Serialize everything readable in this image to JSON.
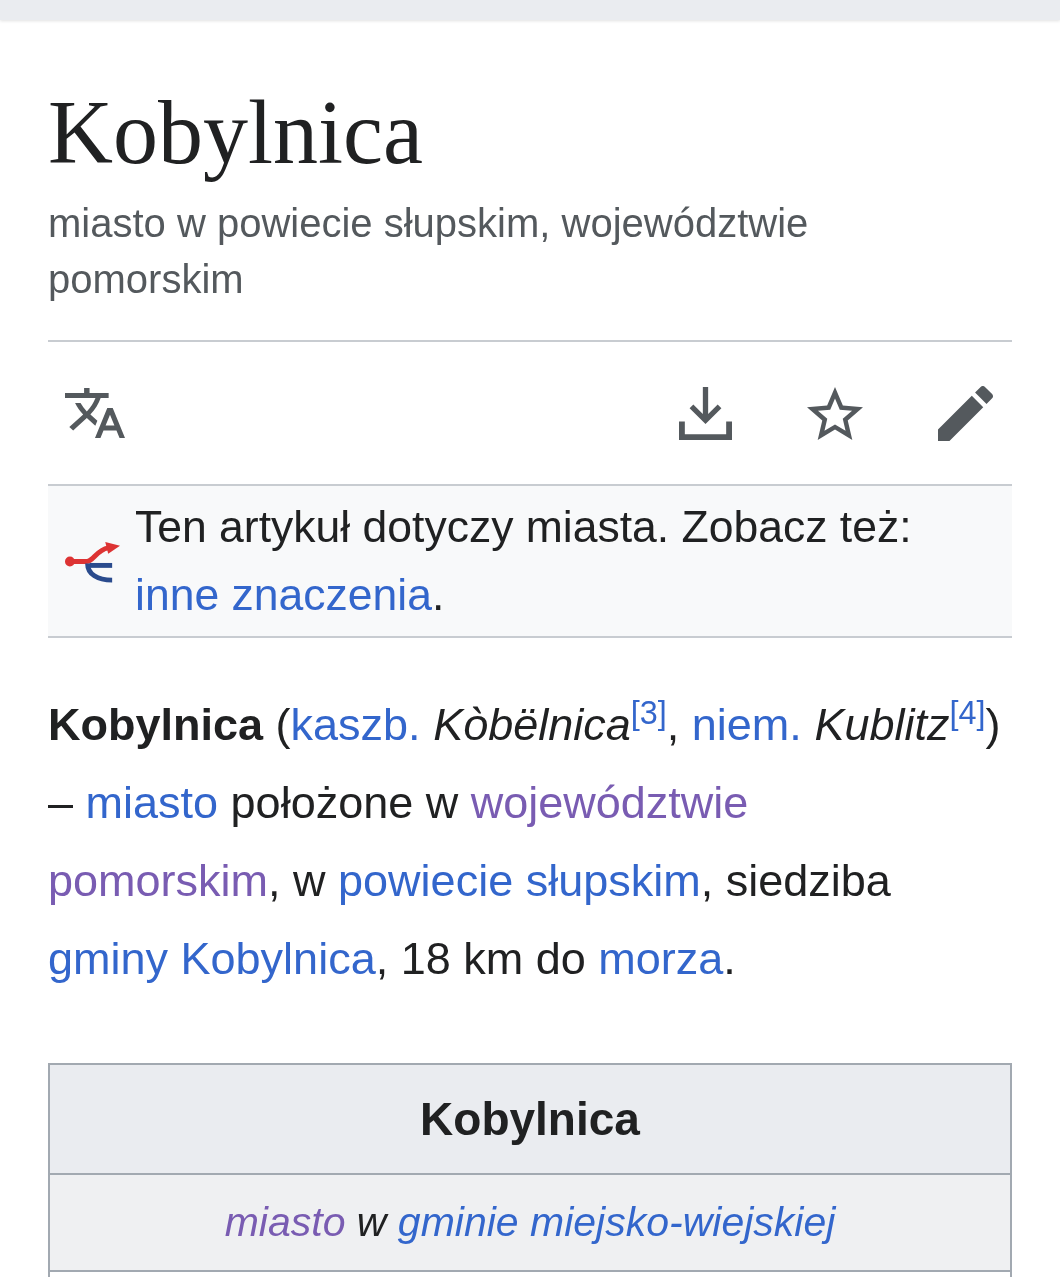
{
  "title": "Kobylnica",
  "description": "miasto w powiecie słupskim, województwie pomorskim",
  "page_actions": [
    {
      "kind": "translate"
    },
    {
      "kind": "download"
    },
    {
      "kind": "star"
    },
    {
      "kind": "edit"
    }
  ],
  "hatnote": [
    {
      "kind": "text",
      "text": "Ten artykuł dotyczy miasta. Zobacz też: "
    },
    {
      "kind": "link",
      "text": "inne znaczenia",
      "visited": false
    },
    {
      "kind": "text",
      "text": "."
    }
  ],
  "lead": [
    {
      "kind": "text",
      "text": "**Kobylnica** ("
    },
    {
      "kind": "link",
      "text": "kaszb.",
      "visited": false
    },
    {
      "kind": "text",
      "text": " *Kòbëlnica*"
    },
    {
      "kind": "ref",
      "text": "[3]",
      "visited": false
    },
    {
      "kind": "text",
      "text": ", "
    },
    {
      "kind": "link",
      "text": "niem.",
      "visited": false
    },
    {
      "kind": "text",
      "text": " *Kublitz*"
    },
    {
      "kind": "ref",
      "text": "[4]",
      "visited": false
    },
    {
      "kind": "text",
      "text": ") – "
    },
    {
      "kind": "link",
      "text": "miasto",
      "visited": false
    },
    {
      "kind": "text",
      "text": " położone w "
    },
    {
      "kind": "link",
      "text": "województwie",
      "visited": true
    },
    {
      "kind": "break"
    },
    {
      "kind": "link",
      "text": "pomorskim",
      "visited": true
    },
    {
      "kind": "text",
      "text": ", w "
    },
    {
      "kind": "link",
      "text": "powiecie słupskim",
      "visited": false
    },
    {
      "kind": "text",
      "text": ", siedziba "
    },
    {
      "kind": "link",
      "text": "gminy Kobylnica",
      "visited": false
    },
    {
      "kind": "text",
      "text": ", 18 km do "
    },
    {
      "kind": "link",
      "text": "morza",
      "visited": false
    },
    {
      "kind": "text",
      "text": "."
    }
  ],
  "infobox": {
    "title": "Kobylnica",
    "caption": [
      {
        "kind": "link",
        "text": "miasto",
        "visited": true
      },
      {
        "kind": "text",
        "text": " w "
      },
      {
        "kind": "link",
        "text": "gminie miejsko-wiejskiej",
        "visited": false
      }
    ]
  }
}
